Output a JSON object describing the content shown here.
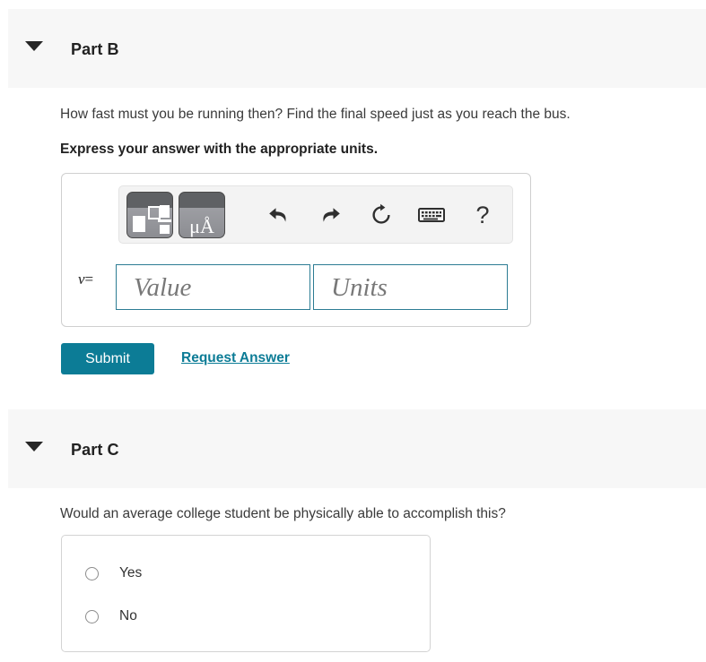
{
  "partB": {
    "caret_icon": "caret-down-icon",
    "title": "Part B",
    "question": "How fast must you be running then? Find the final speed just as you reach the bus.",
    "instruction": "Express your answer with the appropriate units.",
    "toolbar": {
      "template_button_icon": "math-template-palette-icon",
      "units_button_icon": "units-palette-icon",
      "units_button_glyph": "μÅ",
      "undo_icon": "undo-arrow-icon",
      "redo_icon": "redo-arrow-icon",
      "reset_icon": "reset-circular-arrow-icon",
      "keyboard_icon": "keyboard-icon",
      "help_icon": "question-mark-icon",
      "help_glyph": "?"
    },
    "variable_label": "v",
    "equals_sign": "=",
    "value_placeholder": "Value",
    "units_placeholder": "Units",
    "value_current": "",
    "units_current": "",
    "submit_label": "Submit",
    "request_answer_label": "Request Answer"
  },
  "partC": {
    "caret_icon": "caret-down-icon",
    "title": "Part C",
    "question": "Would an average college student be physically able to accomplish this?",
    "choices": [
      {
        "label": "Yes",
        "selected": false
      },
      {
        "label": "No",
        "selected": false
      }
    ]
  },
  "colors": {
    "accent_teal": "#0c7c96",
    "header_band": "#f7f7f7",
    "field_border": "#2c7c93",
    "box_border": "#cfcfcf",
    "text": "#333333"
  }
}
